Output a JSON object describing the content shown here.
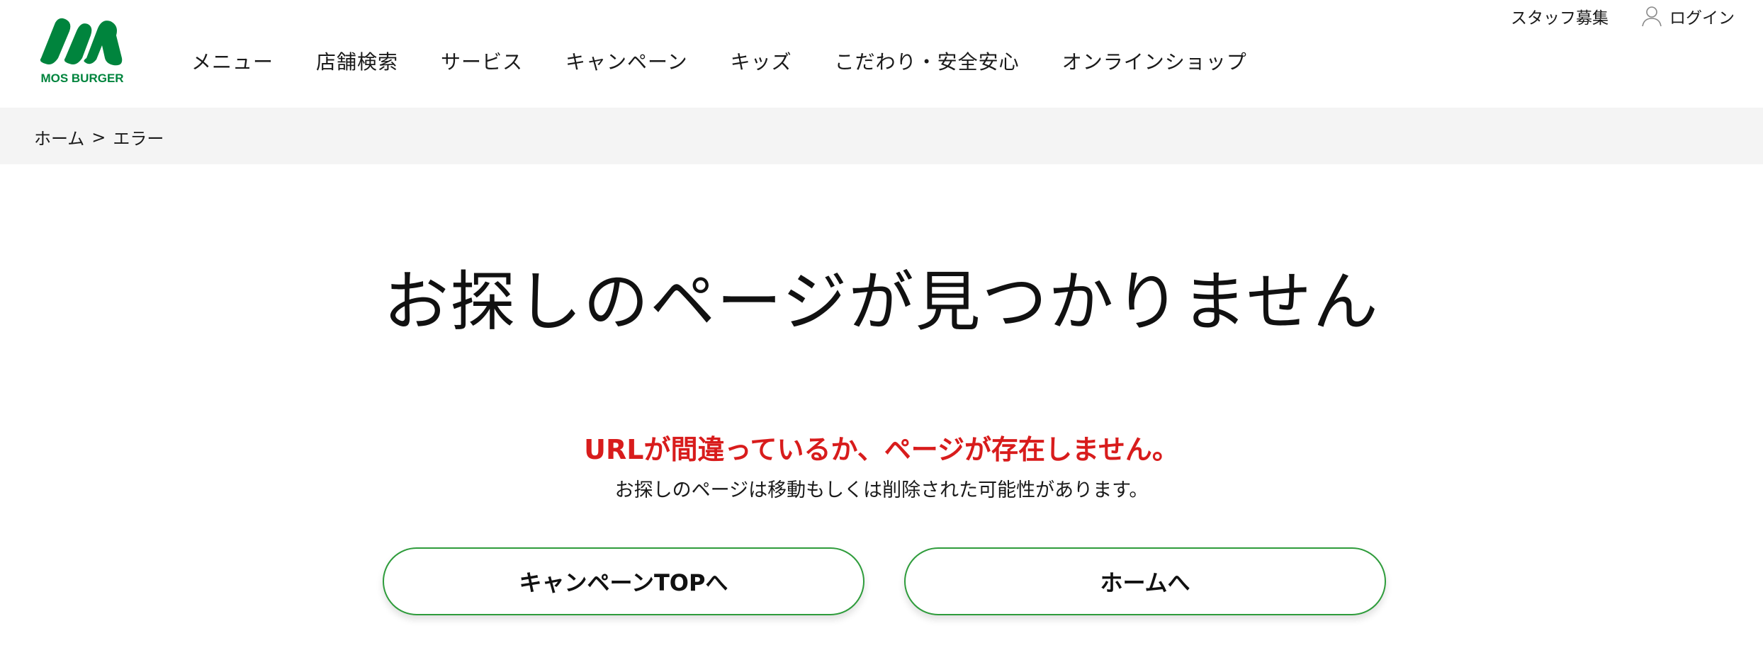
{
  "brand": {
    "logo_text": "MOS BURGER",
    "color": "#00843d"
  },
  "header": {
    "nav": [
      {
        "label": "メニュー"
      },
      {
        "label": "店舗検索"
      },
      {
        "label": "サービス"
      },
      {
        "label": "キャンペーン"
      },
      {
        "label": "キッズ"
      },
      {
        "label": "こだわり・安全安心"
      },
      {
        "label": "オンラインショップ"
      }
    ],
    "utility": {
      "staff_label": "スタッフ募集",
      "login_label": "ログイン",
      "login_icon": "user-icon"
    }
  },
  "breadcrumb": {
    "home": "ホーム",
    "separator": ">",
    "current": "エラー"
  },
  "main": {
    "title": "お探しのページが見つかりません",
    "error_message": "URLが間違っているか、ページが存在しません。",
    "sub_message": "お探しのページは移動もしくは削除された可能性があります。",
    "error_color": "#d81c1c",
    "buttons": {
      "campaign_label": "キャンペーンTOPへ",
      "home_label": "ホームへ",
      "border_color": "#2e9c3b"
    }
  }
}
